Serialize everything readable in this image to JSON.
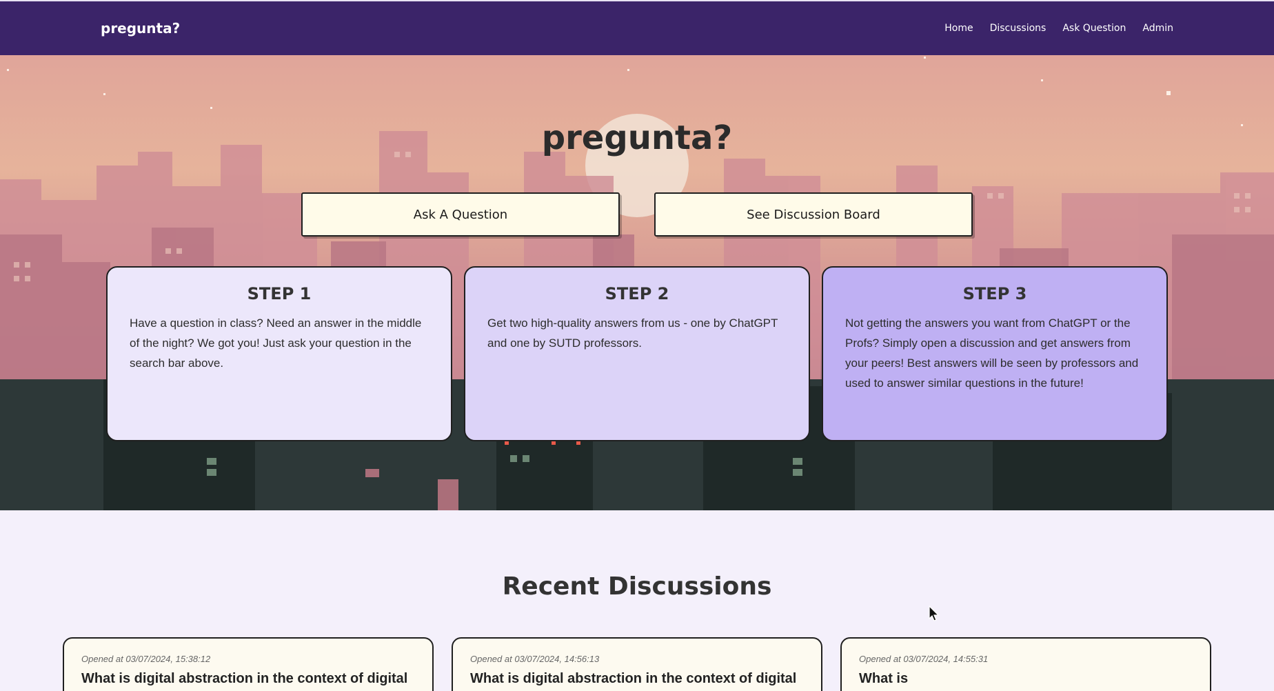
{
  "navbar": {
    "brand": "pregunta?",
    "links": [
      "Home",
      "Discussions",
      "Ask Question",
      "Admin"
    ],
    "bg_color": "#3b2469"
  },
  "hero": {
    "title": "pregunta?",
    "buttons": {
      "ask": "Ask A Question",
      "board": "See Discussion Board"
    },
    "steps": [
      {
        "title": "STEP 1",
        "text": "Have a question in class? Need an answer in the middle of the night? We got you! Just ask your question in the search bar above.",
        "color": "#ece7fb"
      },
      {
        "title": "STEP 2",
        "text": "Get two high-quality answers from us - one by ChatGPT and one by SUTD professors.",
        "color": "#dcd3f8"
      },
      {
        "title": "STEP 3",
        "text": "Not getting the answers you want from ChatGPT or the Profs? Simply open a discussion and get answers from your peers! Best answers will be seen by professors and used to answer similar questions in the future!",
        "color": "#bfb0f3"
      }
    ]
  },
  "recent": {
    "title": "Recent Discussions",
    "cards": [
      {
        "date": "Opened at 03/07/2024, 15:38:12",
        "question": "What is digital abstraction in the context of digital"
      },
      {
        "date": "Opened at 03/07/2024, 14:56:13",
        "question": "What is digital abstraction in the context of digital"
      },
      {
        "date": "Opened at 03/07/2024, 14:55:31",
        "question": "What is"
      }
    ]
  },
  "icons": {
    "cursor": "mouse-pointer-icon"
  }
}
